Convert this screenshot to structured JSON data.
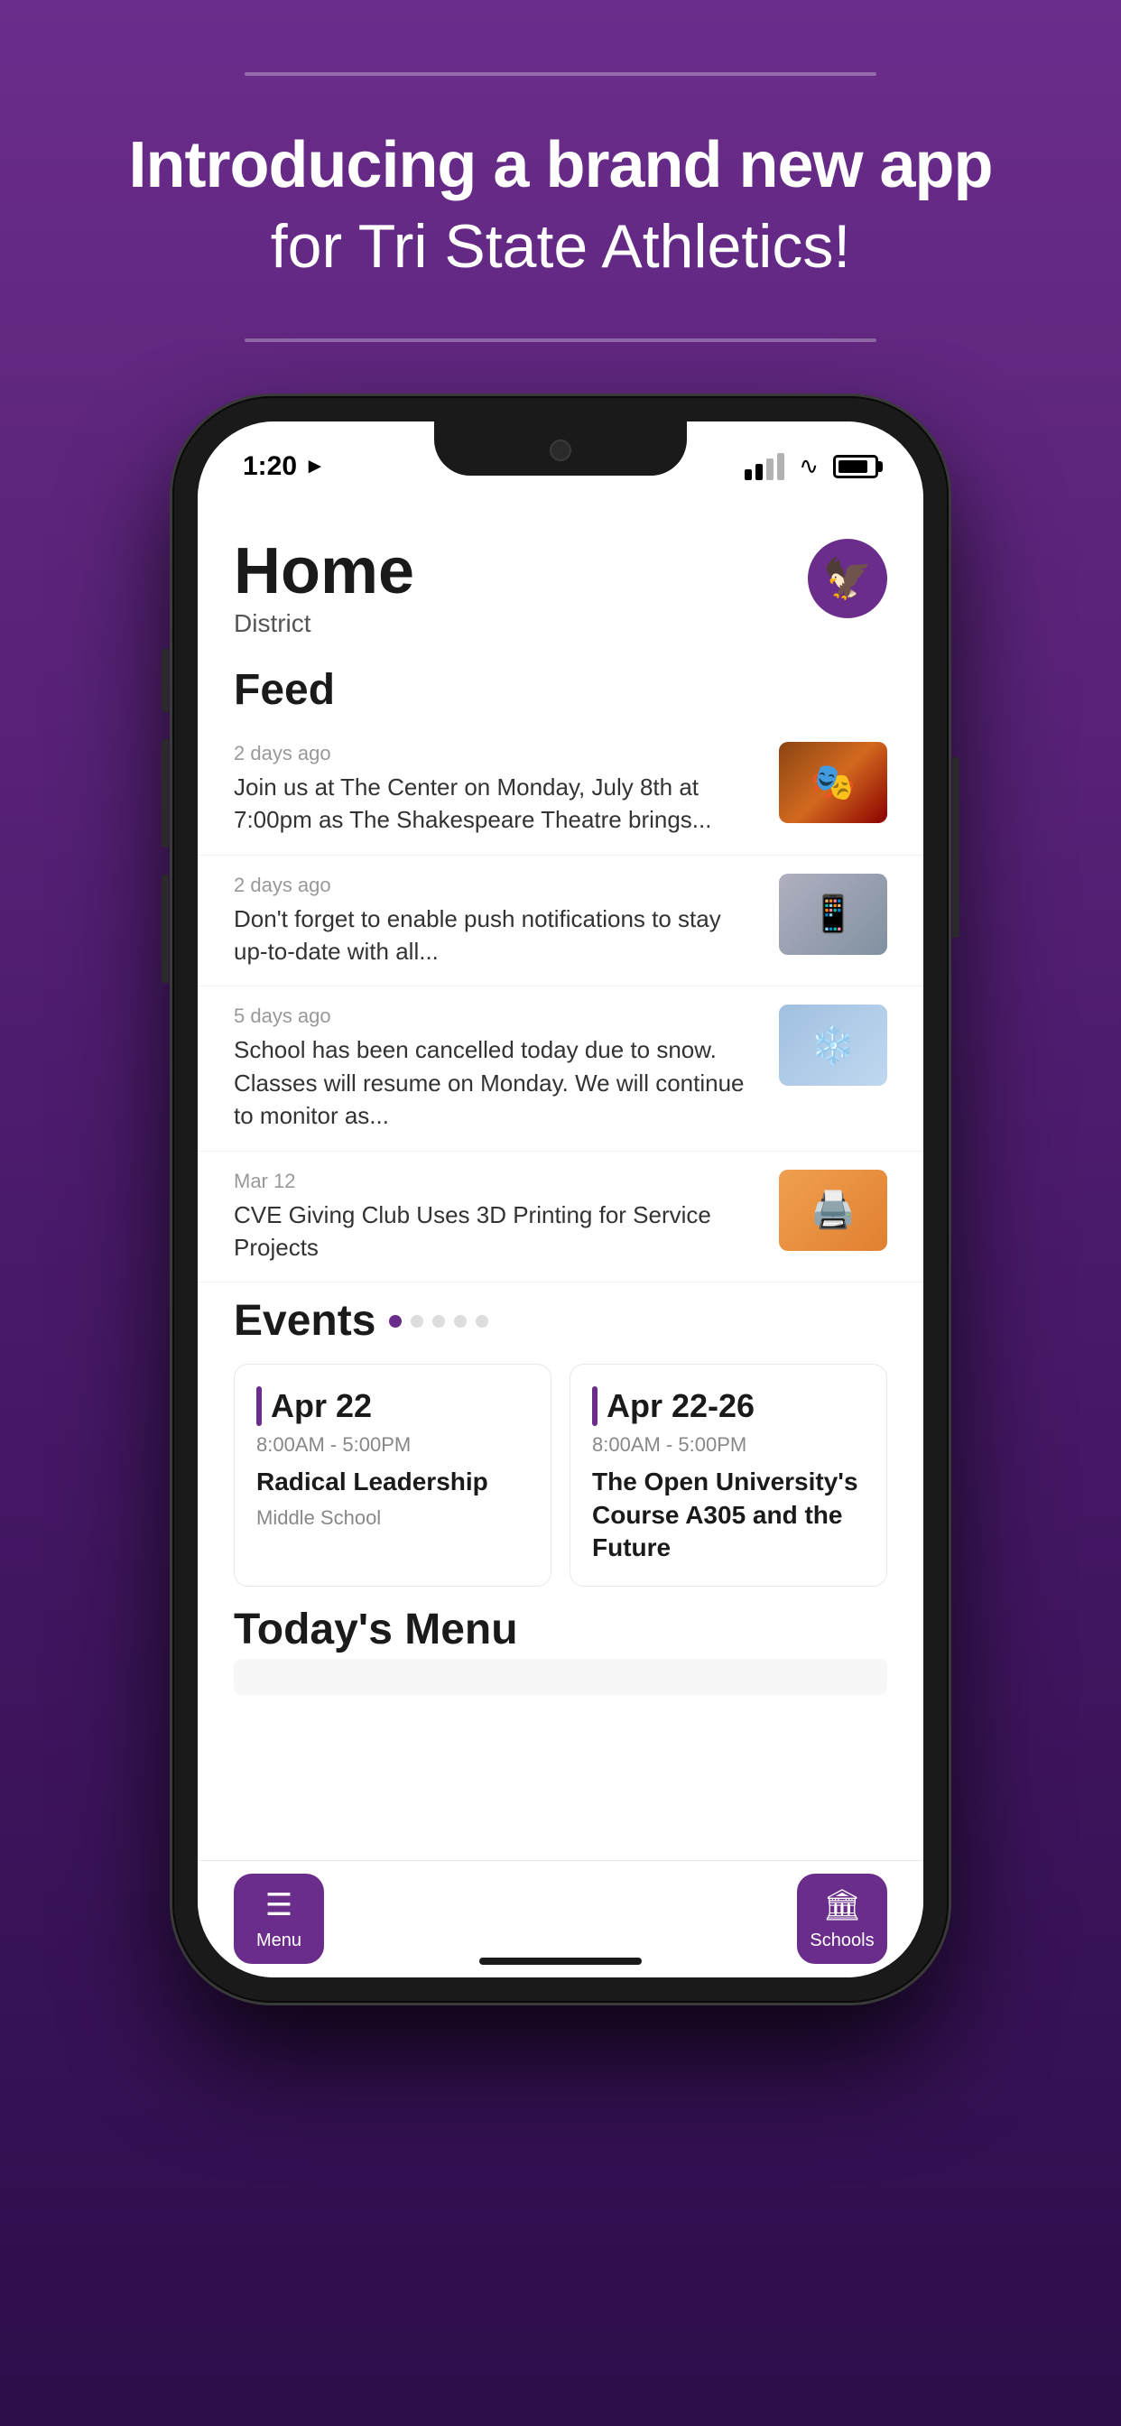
{
  "page": {
    "background": "purple-gradient",
    "headline": {
      "line1": "Introducing a brand new app",
      "line2": "for Tri State Athletics!"
    }
  },
  "phone": {
    "status_bar": {
      "time": "1:20",
      "signal": "2 bars",
      "wifi": true,
      "battery": "full"
    },
    "app": {
      "header": {
        "title": "Home",
        "subtitle": "District"
      },
      "feed": {
        "section_label": "Feed",
        "items": [
          {
            "meta": "2 days ago",
            "text": "Join us at The Center on Monday, July 8th at 7:00pm as The Shakespeare Theatre brings...",
            "thumb_type": "theatre"
          },
          {
            "meta": "2 days ago",
            "text": "Don't forget to enable push notifications to stay up-to-date with all...",
            "thumb_type": "phone"
          },
          {
            "meta": "5 days ago",
            "text": "School has been cancelled today due to snow. Classes will resume on Monday. We will continue to monitor as...",
            "thumb_type": "snow"
          },
          {
            "meta": "Mar 12",
            "text": "CVE Giving Club Uses 3D Printing for Service Projects",
            "thumb_type": "printing"
          }
        ]
      },
      "events": {
        "section_label": "Events",
        "dots": [
          true,
          false,
          false,
          false,
          false
        ],
        "cards": [
          {
            "date": "Apr 22",
            "time": "8:00AM - 5:00PM",
            "name": "Radical Leadership",
            "school": "Middle School"
          },
          {
            "date": "Apr 22-26",
            "time": "8:00AM - 5:00PM",
            "name": "The Open University's Course A305 and the Future",
            "school": ""
          }
        ]
      },
      "todays_menu": {
        "section_label": "Today's Menu"
      },
      "tab_bar": {
        "items": [
          {
            "icon": "menu",
            "label": "Menu",
            "active": false
          },
          {
            "icon": "schools",
            "label": "Schools",
            "active": false
          }
        ]
      }
    }
  }
}
